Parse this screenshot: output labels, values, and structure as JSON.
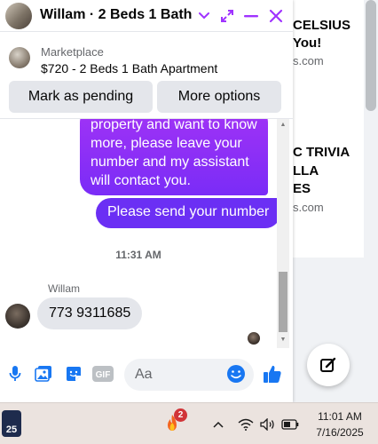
{
  "background_page": {
    "item1_title_l1": "CELSIUS",
    "item1_title_l2": "You!",
    "item1_sub": "s.com",
    "item2_title_l1": "C TRIVIA",
    "item2_title_l2": "LLA",
    "item2_title_l3": "ES",
    "item2_sub": "s.com",
    "compose_icon": "compose-icon"
  },
  "header": {
    "title": "Willam · 2 Beds 1 Bath ...",
    "icons": [
      "chevron-down-icon",
      "expand-icon",
      "minimize-icon",
      "close-icon"
    ],
    "accent": "#a033ff"
  },
  "listing": {
    "source": "Marketplace",
    "title": "$720 - 2 Beds 1 Bath Apartment"
  },
  "actions": {
    "mark_pending": "Mark as pending",
    "more_options": "More options"
  },
  "messages": {
    "outgoing_long": "property and want to know more, please leave your number and my assistant will contact you.",
    "outgoing_send": "Please send your number",
    "timestamp": "11:31 AM",
    "sender_name": "Willam",
    "incoming_phone": "773 9311685"
  },
  "composer": {
    "placeholder": "Aa",
    "icons": [
      "microphone-icon",
      "photo-icon",
      "sticker-icon",
      "gif-icon",
      "emoji-icon",
      "thumbs-up-icon"
    ],
    "gif_label": "GIF"
  },
  "taskbar": {
    "app_badge_number": "25",
    "notification_count": "2",
    "time": "11:01 AM",
    "date": "7/16/2025",
    "tray_icons": [
      "chevron-up-icon",
      "wifi-icon",
      "volume-icon",
      "battery-icon"
    ]
  }
}
